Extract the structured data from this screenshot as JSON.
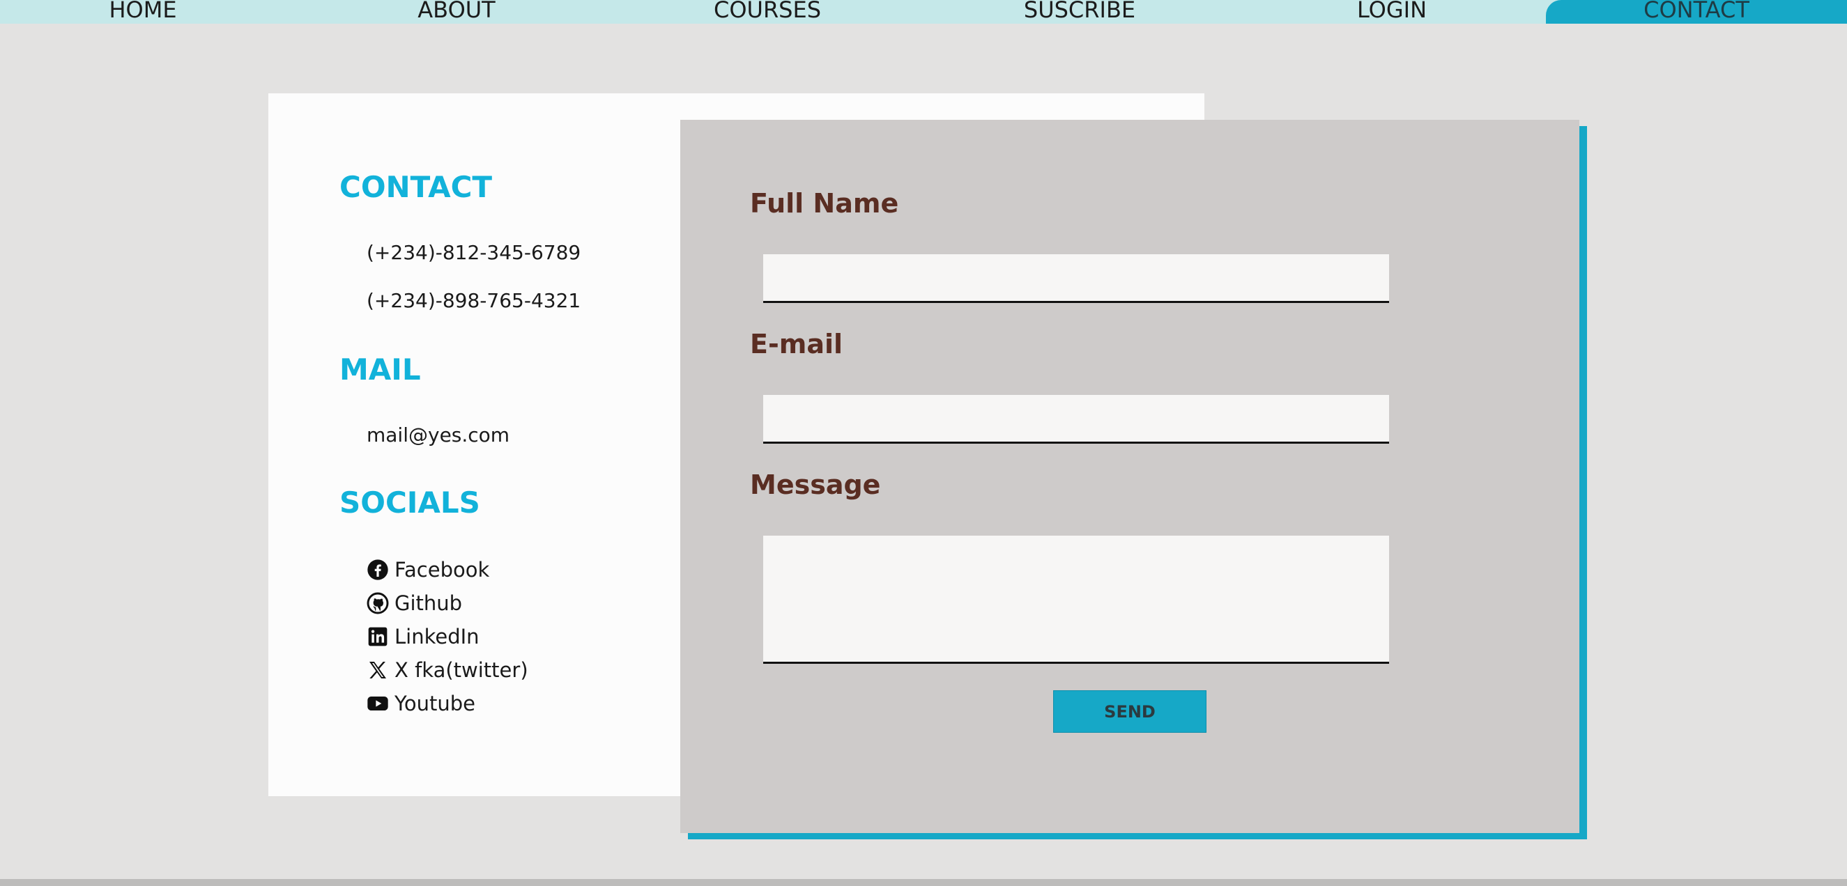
{
  "nav": {
    "items": [
      {
        "label": "HOME"
      },
      {
        "label": "ABOUT"
      },
      {
        "label": "COURSES"
      },
      {
        "label": "SUSCRIBE"
      },
      {
        "label": "LOGIN"
      },
      {
        "label": "CONTACT",
        "active": true
      }
    ]
  },
  "info": {
    "contact_heading": "CONTACT",
    "phones": [
      "(+234)-812-345-6789",
      "(+234)-898-765-4321"
    ],
    "mail_heading": "MAIL",
    "email": "mail@yes.com",
    "socials_heading": "SOCIALS",
    "socials": [
      {
        "label": "Facebook",
        "icon": "facebook-icon"
      },
      {
        "label": "Github",
        "icon": "github-icon"
      },
      {
        "label": "LinkedIn",
        "icon": "linkedin-icon"
      },
      {
        "label": "X fka(twitter)",
        "icon": "x-icon"
      },
      {
        "label": "Youtube",
        "icon": "youtube-icon"
      }
    ]
  },
  "form": {
    "full_name_label": "Full Name",
    "full_name_value": "",
    "email_label": "E-mail",
    "email_value": "",
    "message_label": "Message",
    "message_value": "",
    "send_label": "SEND"
  },
  "colors": {
    "accent": "#16a8c7",
    "heading": "#12b2da",
    "label": "#5a2d22",
    "nav_bg": "#c5e8e9",
    "page_bg": "#e3e2e1",
    "panel_bg": "#cecbca"
  }
}
